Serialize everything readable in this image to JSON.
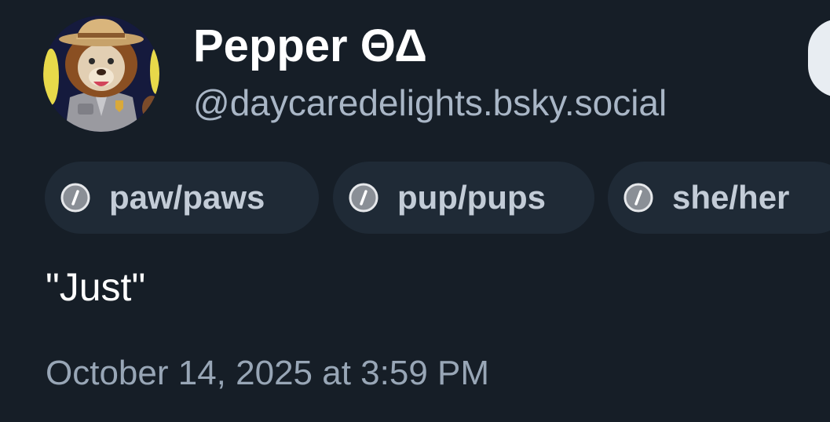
{
  "profile": {
    "display_name": "Pepper ΘΔ",
    "handle": "@daycaredelights.bsky.social",
    "avatar_icon": "fursona-ranger-avatar"
  },
  "pronoun_pills": [
    {
      "icon": "pronoun-slash-icon",
      "label": "paw/paws"
    },
    {
      "icon": "pronoun-slash-icon",
      "label": "pup/pups"
    },
    {
      "icon": "pronoun-slash-icon",
      "label": "she/her"
    }
  ],
  "post": {
    "text": "\"Just\"",
    "timestamp": "October 14, 2025 at 3:59 PM"
  },
  "colors": {
    "background": "#161e27",
    "pill_background": "#1f2a36",
    "secondary_text": "#a9b6c6",
    "primary_text": "#ffffff"
  }
}
